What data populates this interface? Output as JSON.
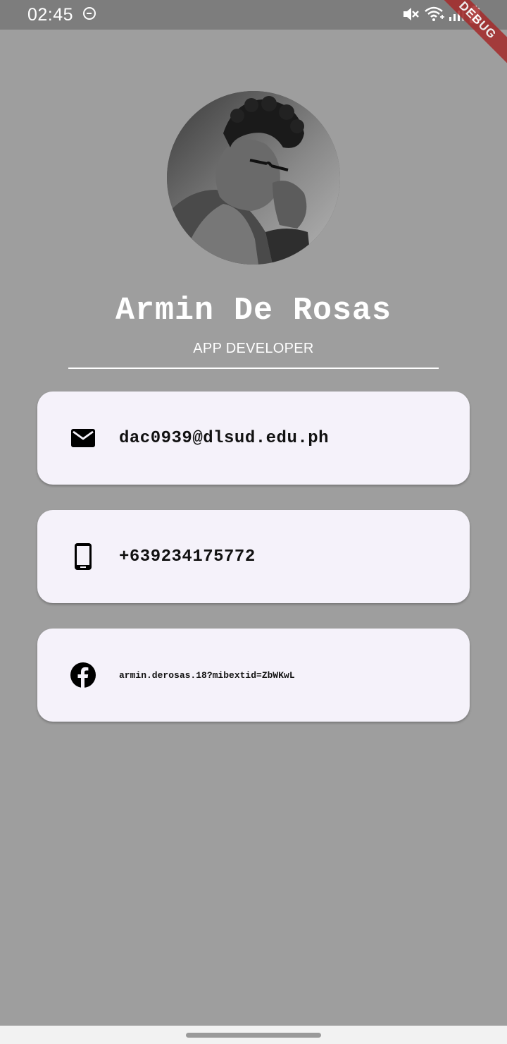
{
  "status_bar": {
    "time": "02:45",
    "icons": [
      "do-not-disturb-icon",
      "mute-icon",
      "wifi-icon",
      "signal-icon",
      "battery-icon"
    ]
  },
  "debug_banner": "DEBUG",
  "profile": {
    "name": "Armin De Rosas",
    "title": "APP DEVELOPER"
  },
  "contacts": [
    {
      "icon": "email-icon",
      "text": "dac0939@dlsud.edu.ph"
    },
    {
      "icon": "phone-icon",
      "text": "+639234175772"
    },
    {
      "icon": "facebook-icon",
      "text": "armin.derosas.18?mibextid=ZbWKwL"
    }
  ],
  "colors": {
    "background": "#9e9e9e",
    "status_bar": "#7d7d7d",
    "card": "#f5f2fa",
    "debug_banner": "#a52a2a",
    "text_on_background": "#ffffff"
  }
}
